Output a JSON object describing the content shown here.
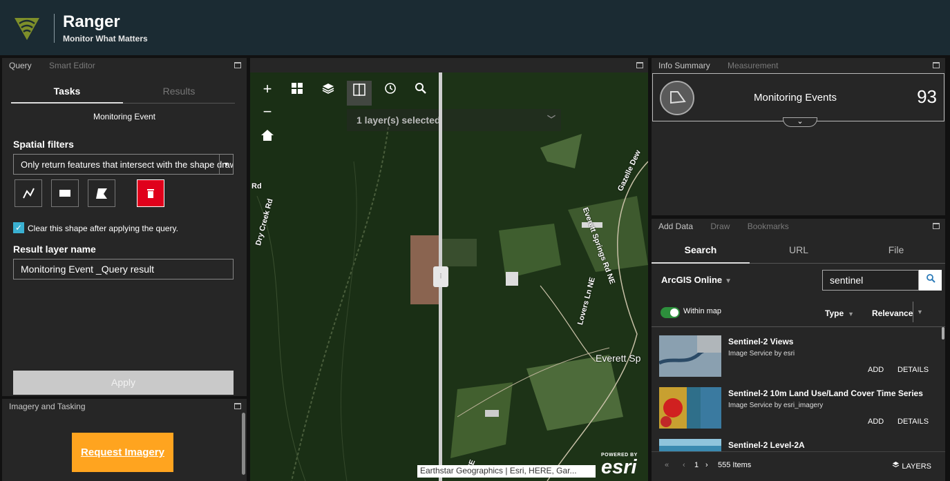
{
  "header": {
    "title": "Ranger",
    "subtitle": "Monitor What Matters"
  },
  "query_panel": {
    "tabs": [
      "Query",
      "Smart Editor"
    ],
    "subtabs": [
      "Tasks",
      "Results"
    ],
    "task_name": "Monitoring Event",
    "spatial_filters_label": "Spatial filters",
    "spatial_select_value": "Only return features that intersect with the shape drawn",
    "clear_shape_label": "Clear this shape after applying the query.",
    "result_layer_label": "Result layer name",
    "result_layer_value": "Monitoring Event _Query result",
    "apply_label": "Apply"
  },
  "imagery_panel": {
    "title": "Imagery and Tasking",
    "request_label": "Request Imagery"
  },
  "map": {
    "layer_select_text": "1 layer(s) selected",
    "attribution": "Earthstar Geographics | Esri, HERE, Gar...",
    "esri_powered": "POWERED BY",
    "esri_name": "esri",
    "labels": {
      "dry_creek": "Dry Creek Rd",
      "rd": "Rd",
      "everett_springs": "Everett Springs Rd NE",
      "gazelle": "Gazelle Dew",
      "lovers_ln": "Lovers Ln NE",
      "everett": "Everett Sp",
      "ne": "NE"
    }
  },
  "info_summary": {
    "tabs": [
      "Info Summary",
      "Measurement"
    ],
    "title": "Monitoring Events",
    "count": "93"
  },
  "add_data": {
    "panel_tabs": [
      "Add Data",
      "Draw",
      "Bookmarks"
    ],
    "tabs": [
      "Search",
      "URL",
      "File"
    ],
    "source": "ArcGIS Online",
    "search_value": "sentinel",
    "within_map_label": "Within map",
    "type_label": "Type",
    "relevance_label": "Relevance",
    "items": [
      {
        "title": "Sentinel-2 Views",
        "subtitle": "Image Service by esri",
        "add": "ADD",
        "details": "DETAILS"
      },
      {
        "title": "Sentinel-2 10m Land Use/Land Cover Time Series",
        "subtitle": "Image Service by esri_imagery",
        "add": "ADD",
        "details": "DETAILS"
      },
      {
        "title": "Sentinel-2 Level-2A",
        "subtitle": "",
        "add": "",
        "details": ""
      }
    ],
    "page": "1",
    "item_count": "555 Items",
    "layers_label": "LAYERS"
  }
}
